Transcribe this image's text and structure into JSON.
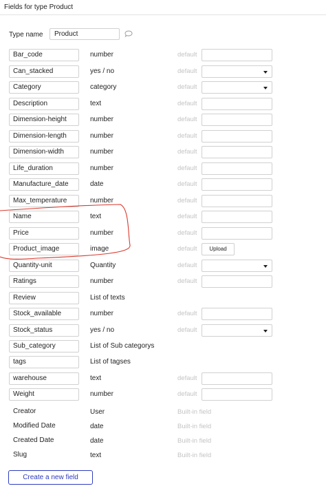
{
  "header": {
    "title": "Fields for type Product"
  },
  "type_name": {
    "label": "Type name",
    "value": "Product"
  },
  "placeholders": {
    "default": "default",
    "builtin": "Built-in field"
  },
  "fields": [
    {
      "name": "Bar_code",
      "type": "number",
      "control": "text"
    },
    {
      "name": "Can_stacked",
      "type": "yes / no",
      "control": "select"
    },
    {
      "name": "Category",
      "type": "category",
      "control": "select"
    },
    {
      "name": "Description",
      "type": "text",
      "control": "text"
    },
    {
      "name": "Dimension-height",
      "type": "number",
      "control": "text"
    },
    {
      "name": "Dimension-length",
      "type": "number",
      "control": "text"
    },
    {
      "name": "Dimension-width",
      "type": "number",
      "control": "text"
    },
    {
      "name": "Life_duration",
      "type": "number",
      "control": "text"
    },
    {
      "name": "Manufacture_date",
      "type": "date",
      "control": "text"
    },
    {
      "name": "Max_temperature",
      "type": "number",
      "control": "text"
    },
    {
      "name": "Name",
      "type": "text",
      "control": "text"
    },
    {
      "name": "Price",
      "type": "number",
      "control": "text"
    },
    {
      "name": "Product_image",
      "type": "image",
      "control": "upload",
      "button_label": "Upload"
    },
    {
      "name": "Quantity-unit",
      "type": "Quantity",
      "control": "select"
    },
    {
      "name": "Ratings",
      "type": "number",
      "control": "text"
    },
    {
      "name": "Review",
      "type": "List of texts",
      "control": "none"
    },
    {
      "name": "Stock_available",
      "type": "number",
      "control": "text"
    },
    {
      "name": "Stock_status",
      "type": "yes / no",
      "control": "select"
    },
    {
      "name": "Sub_category",
      "type": "List of Sub categorys",
      "control": "none"
    },
    {
      "name": "tags",
      "type": "List of tagses",
      "control": "none"
    },
    {
      "name": "warehouse",
      "type": "text",
      "control": "text"
    },
    {
      "name": "Weight",
      "type": "number",
      "control": "text"
    }
  ],
  "builtin_fields": [
    {
      "name": "Creator",
      "type": "User"
    },
    {
      "name": "Modified Date",
      "type": "date"
    },
    {
      "name": "Created Date",
      "type": "date"
    },
    {
      "name": "Slug",
      "type": "text"
    }
  ],
  "create_button": {
    "label": "Create a new field"
  },
  "colors": {
    "accent": "#2d3bbd",
    "annotation": "#d9382c",
    "muted": "#c4c4c4",
    "border": "#d0d0d0"
  }
}
